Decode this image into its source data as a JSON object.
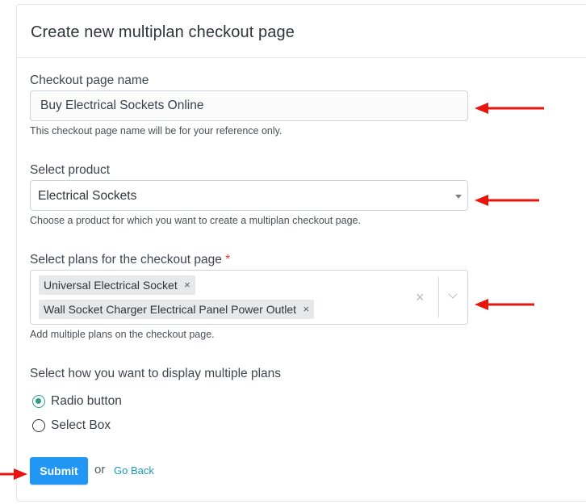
{
  "header": {
    "title": "Create new multiplan checkout page"
  },
  "form": {
    "name_field": {
      "label": "Checkout page name",
      "value": "Buy Electrical Sockets Online",
      "help": "This checkout page name will be for your reference only."
    },
    "product_field": {
      "label": "Select product",
      "selected": "Electrical Sockets",
      "help": "Choose a product for which you want to create a multiplan checkout page."
    },
    "plans_field": {
      "label": "Select plans for the checkout page",
      "required_mark": "*",
      "chips": [
        {
          "label": "Universal Electrical Socket",
          "remove": "×"
        },
        {
          "label": "Wall Socket Charger Electrical Panel Power Outlet",
          "remove": "×"
        }
      ],
      "clear": "×",
      "help": "Add multiple plans on the checkout page."
    },
    "display_field": {
      "label": "Select how you want to display multiple plans",
      "options": [
        {
          "label": "Radio button",
          "checked": true
        },
        {
          "label": "Select Box",
          "checked": false
        }
      ]
    }
  },
  "actions": {
    "submit_label": "Submit",
    "or_text": "or",
    "go_back_label": "Go Back"
  },
  "colors": {
    "accent": "#2196f3",
    "radio_accent": "#2a9d8f",
    "link": "#1a9bb5",
    "annotation_arrow": "#e8140e"
  }
}
